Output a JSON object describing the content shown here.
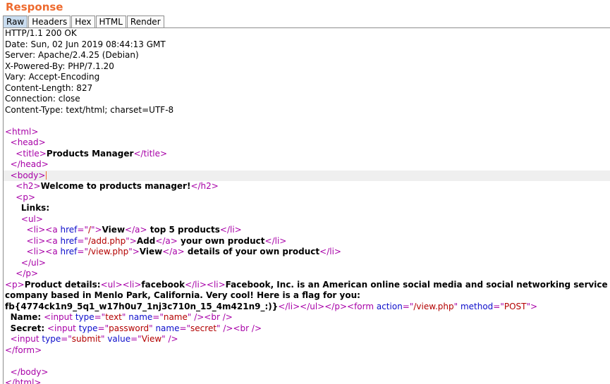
{
  "section_title": "Response",
  "tabs": [
    {
      "label": "Raw",
      "active": true
    },
    {
      "label": "Headers",
      "active": false
    },
    {
      "label": "Hex",
      "active": false
    },
    {
      "label": "HTML",
      "active": false
    },
    {
      "label": "Render",
      "active": false
    }
  ],
  "headers": [
    "HTTP/1.1 200 OK",
    "Date: Sun, 02 Jun 2019 08:44:13 GMT",
    "Server: Apache/2.4.25 (Debian)",
    "X-Powered-By: PHP/7.1.20",
    "Vary: Accept-Encoding",
    "Content-Length: 827",
    "Connection: close",
    "Content-Type: text/html; charset=UTF-8"
  ],
  "body": {
    "page_title": "Products Manager",
    "heading": "Welcome to products manager!",
    "links_label": "Links:",
    "links": [
      {
        "href": "/",
        "anchor": "View",
        "rest": " top 5 products"
      },
      {
        "href": "/add.php",
        "anchor": "Add",
        "rest": " your own product"
      },
      {
        "href": "/view.php",
        "anchor": "View",
        "rest": " details of your own product"
      }
    ],
    "details_label": "Product details:",
    "product_name": "facebook",
    "product_desc_1": "Facebook, Inc. is an American online social media and social networking service",
    "product_desc_2": "company based in Menlo Park, California. Very cool! Here is a flag for you:",
    "flag": "fb{4774ck1n9_5q1_w17h0u7_1nj3c710n_15_4m421n9_:)}",
    "form_action": "/view.php",
    "form_method": "POST",
    "name_label": "Name:",
    "secret_label": "Secret:",
    "submit_value": "View"
  },
  "colors": {
    "accent": "#ee6b2f",
    "tag": "#a700a7",
    "attr": "#0d0dcb",
    "value": "#b30000",
    "active_tab": "#c9dcef"
  }
}
